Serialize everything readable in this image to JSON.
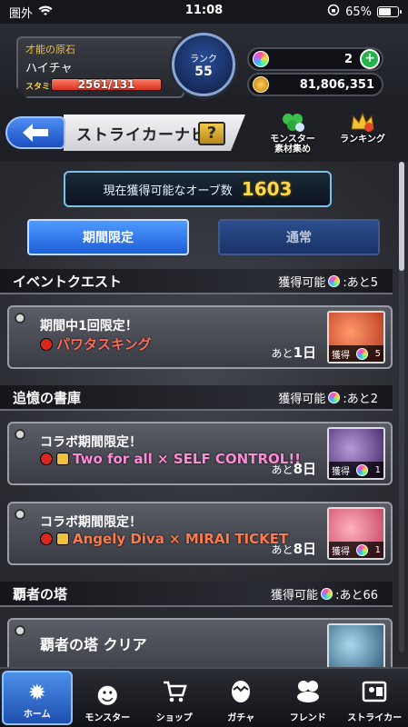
{
  "status": {
    "carrier": "圏外",
    "time": "11:08",
    "battery": "65%",
    "battery_level": 0.65
  },
  "player": {
    "talent": "才能の原石",
    "name": "ハイチャ",
    "stamina_label": "スタミナ",
    "stamina": "2561/131",
    "rank_label": "ランク",
    "rank": "55",
    "orbs": "2",
    "coins": "81,806,351"
  },
  "titlebar": {
    "title": "ストライカーナビ",
    "help": "?",
    "monster_caption": "モンスター\n素材集め",
    "ranking_caption": "ランキング"
  },
  "orb_count": {
    "label": "現在獲得可能なオーブ数",
    "value": "1603"
  },
  "tabs": {
    "limited": "期間限定",
    "normal": "通常"
  },
  "sections": [
    {
      "title": "イベントクエスト",
      "avail": "獲得可能",
      "remain": ":あと5"
    },
    {
      "title": "追憶の書庫",
      "avail": "獲得可能",
      "remain": ":あと2"
    },
    {
      "title": "覇者の塔",
      "avail": "獲得可能",
      "remain": ":あと66"
    }
  ],
  "cards": [
    {
      "title": "期間中1回限定！",
      "sub": "パワタスキング",
      "remain_prefix": "あと",
      "remain": "1日",
      "acq": "獲得",
      "count": "5"
    },
    {
      "title": "コラボ期間限定！",
      "sub": "Two for all × SELF CONTROL!!",
      "remain_prefix": "あと",
      "remain": "8日",
      "acq": "獲得",
      "count": "1"
    },
    {
      "title": "コラボ期間限定！",
      "sub": "Angely Diva × MIRAI TICKET",
      "remain_prefix": "あと",
      "remain": "8日",
      "acq": "獲得",
      "count": "1"
    },
    {
      "title": "覇者の塔 クリア"
    }
  ],
  "nav": [
    {
      "label": "ホーム",
      "icon": "home-icon"
    },
    {
      "label": "モンスター",
      "icon": "monster-icon"
    },
    {
      "label": "ショップ",
      "icon": "cart-icon"
    },
    {
      "label": "ガチャ",
      "icon": "egg-icon"
    },
    {
      "label": "フレンド",
      "icon": "friend-icon"
    },
    {
      "label": "ストライカー",
      "icon": "striker-icon"
    }
  ]
}
